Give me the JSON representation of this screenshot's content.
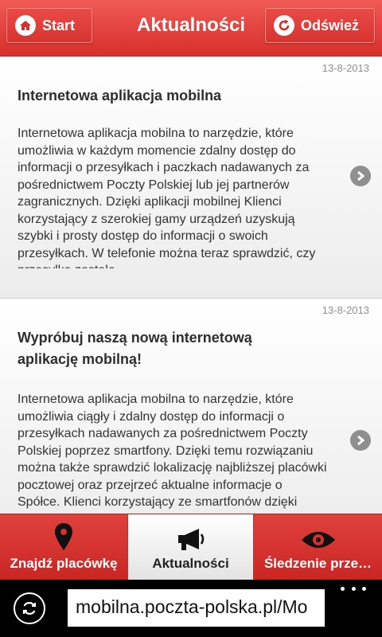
{
  "header": {
    "start_label": "Start",
    "title": "Aktualności",
    "refresh_label": "Odśwież",
    "icons": {
      "start": "home-icon",
      "refresh": "refresh-icon"
    },
    "accent_color": "#d72f2b"
  },
  "news": [
    {
      "date": "13-8-2013",
      "title": "Internetowa aplikacja mobilna",
      "text": "Internetowa aplikacja mobilna to narzędzie, które umożliwia w każdym momencie zdalny dostęp do informacji o przesyłkach i paczkach nadawanych za pośrednictwem Poczty Polskiej lub jej partnerów zagranicznych.   Dzięki aplikacji mobilnej Klienci korzystający z szerokiej gamy urządzeń uzyskują szybki i prosty dostęp do informacji o swoich przesyłkach. W telefonie można teraz sprawdzić, czy przesyłka została..."
    },
    {
      "date": "13-8-2013",
      "title": "Wypróbuj naszą nową internetową aplikację mobilną!",
      "text": "Internetowa aplikacja mobilna to narzędzie, które umożliwia ciągły i zdalny dostęp do informacji o przesyłkach nadawanych za pośrednictwem Poczty Polskiej poprzez smartfony. Dzięki temu rozwiązaniu można także sprawdzić lokalizację najbliższej placówki pocztowej oraz  przejrzeć aktualne informacje o Spółce. Klienci korzystający ze smartfonów dzięki aplikacji"
    }
  ],
  "tabs": [
    {
      "label": "Znajdź placówkę",
      "icon": "location-pin-icon"
    },
    {
      "label": "Aktualności",
      "icon": "megaphone-icon",
      "active": true
    },
    {
      "label": "Śledzenie prze…",
      "icon": "eye-icon"
    }
  ],
  "browser": {
    "url": "mobilna.poczta-polska.pl/Mo",
    "icons": {
      "refresh": "browser-refresh-icon",
      "menu": "more-dots-icon"
    }
  }
}
